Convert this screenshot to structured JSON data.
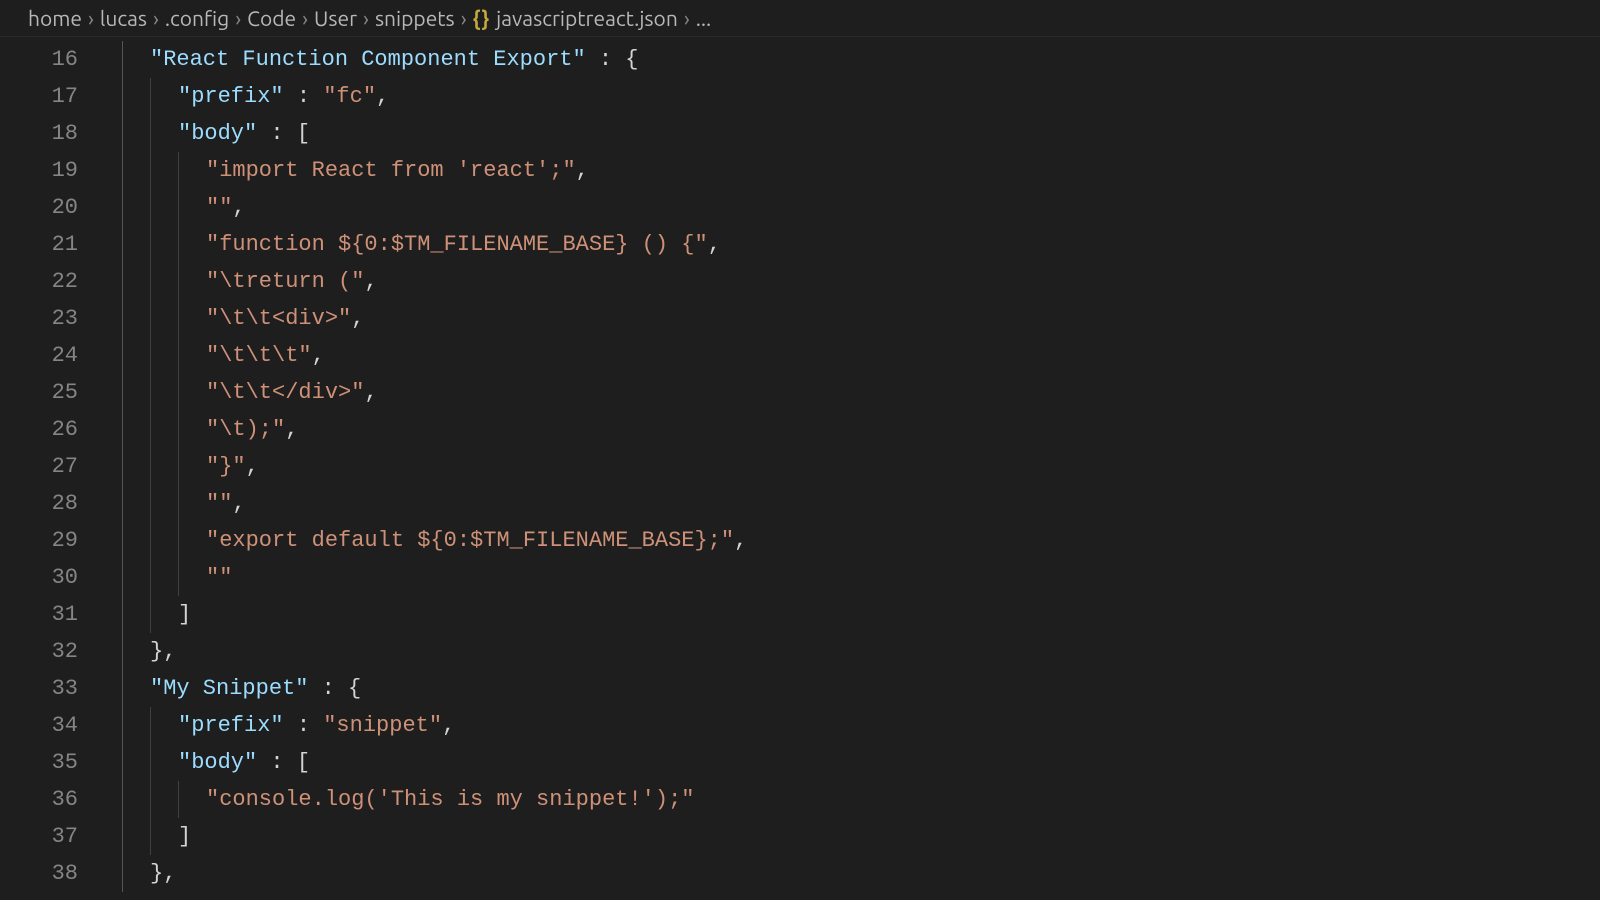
{
  "breadcrumbs": {
    "items": [
      "home",
      "lucas",
      ".config",
      "Code",
      "User",
      "snippets"
    ],
    "file": "javascriptreact.json",
    "tail": "..."
  },
  "colors": {
    "background": "#1e1e1e",
    "gutter": "#858585",
    "string": "#ce9178",
    "key": "#9cdcfe",
    "punctuation": "#d4d4d4"
  },
  "first_line_number": 16,
  "lines": [
    {
      "n": 16,
      "indent": 1,
      "tokens": [
        [
          "key",
          "\"React Function Component Export\""
        ],
        [
          "punc",
          " : "
        ],
        [
          "brace",
          "{"
        ]
      ]
    },
    {
      "n": 17,
      "indent": 2,
      "tokens": [
        [
          "key",
          "\"prefix\""
        ],
        [
          "punc",
          " : "
        ],
        [
          "str",
          "\"fc\""
        ],
        [
          "punc",
          ","
        ]
      ]
    },
    {
      "n": 18,
      "indent": 2,
      "tokens": [
        [
          "key",
          "\"body\""
        ],
        [
          "punc",
          " : "
        ],
        [
          "brace",
          "["
        ]
      ]
    },
    {
      "n": 19,
      "indent": 3,
      "tokens": [
        [
          "str",
          "\"import React from 'react';\""
        ],
        [
          "punc",
          ","
        ]
      ]
    },
    {
      "n": 20,
      "indent": 3,
      "tokens": [
        [
          "str",
          "\"\""
        ],
        [
          "punc",
          ","
        ]
      ]
    },
    {
      "n": 21,
      "indent": 3,
      "tokens": [
        [
          "str",
          "\"function ${0:$TM_FILENAME_BASE} () {\""
        ],
        [
          "punc",
          ","
        ]
      ]
    },
    {
      "n": 22,
      "indent": 3,
      "tokens": [
        [
          "str",
          "\"\\treturn (\""
        ],
        [
          "punc",
          ","
        ]
      ]
    },
    {
      "n": 23,
      "indent": 3,
      "tokens": [
        [
          "str",
          "\"\\t\\t<div>\""
        ],
        [
          "punc",
          ","
        ]
      ]
    },
    {
      "n": 24,
      "indent": 3,
      "tokens": [
        [
          "str",
          "\"\\t\\t\\t\""
        ],
        [
          "punc",
          ","
        ]
      ]
    },
    {
      "n": 25,
      "indent": 3,
      "tokens": [
        [
          "str",
          "\"\\t\\t</div>\""
        ],
        [
          "punc",
          ","
        ]
      ]
    },
    {
      "n": 26,
      "indent": 3,
      "tokens": [
        [
          "str",
          "\"\\t);\""
        ],
        [
          "punc",
          ","
        ]
      ]
    },
    {
      "n": 27,
      "indent": 3,
      "tokens": [
        [
          "str",
          "\"}\""
        ],
        [
          "punc",
          ","
        ]
      ]
    },
    {
      "n": 28,
      "indent": 3,
      "tokens": [
        [
          "str",
          "\"\""
        ],
        [
          "punc",
          ","
        ]
      ]
    },
    {
      "n": 29,
      "indent": 3,
      "tokens": [
        [
          "str",
          "\"export default ${0:$TM_FILENAME_BASE};\""
        ],
        [
          "punc",
          ","
        ]
      ]
    },
    {
      "n": 30,
      "indent": 3,
      "tokens": [
        [
          "str",
          "\"\""
        ]
      ]
    },
    {
      "n": 31,
      "indent": 2,
      "tokens": [
        [
          "brace",
          "]"
        ]
      ]
    },
    {
      "n": 32,
      "indent": 1,
      "tokens": [
        [
          "brace",
          "}"
        ],
        [
          "punc",
          ","
        ]
      ]
    },
    {
      "n": 33,
      "indent": 1,
      "tokens": [
        [
          "key",
          "\"My Snippet\""
        ],
        [
          "punc",
          " : "
        ],
        [
          "brace",
          "{"
        ]
      ]
    },
    {
      "n": 34,
      "indent": 2,
      "tokens": [
        [
          "key",
          "\"prefix\""
        ],
        [
          "punc",
          " : "
        ],
        [
          "str",
          "\"snippet\""
        ],
        [
          "punc",
          ","
        ]
      ]
    },
    {
      "n": 35,
      "indent": 2,
      "tokens": [
        [
          "key",
          "\"body\""
        ],
        [
          "punc",
          " : "
        ],
        [
          "brace",
          "["
        ]
      ]
    },
    {
      "n": 36,
      "indent": 3,
      "tokens": [
        [
          "str",
          "\"console.log('This is my snippet!');\""
        ]
      ]
    },
    {
      "n": 37,
      "indent": 2,
      "tokens": [
        [
          "brace",
          "]"
        ]
      ]
    },
    {
      "n": 38,
      "indent": 1,
      "tokens": [
        [
          "brace",
          "}"
        ],
        [
          "punc",
          ","
        ]
      ]
    }
  ]
}
